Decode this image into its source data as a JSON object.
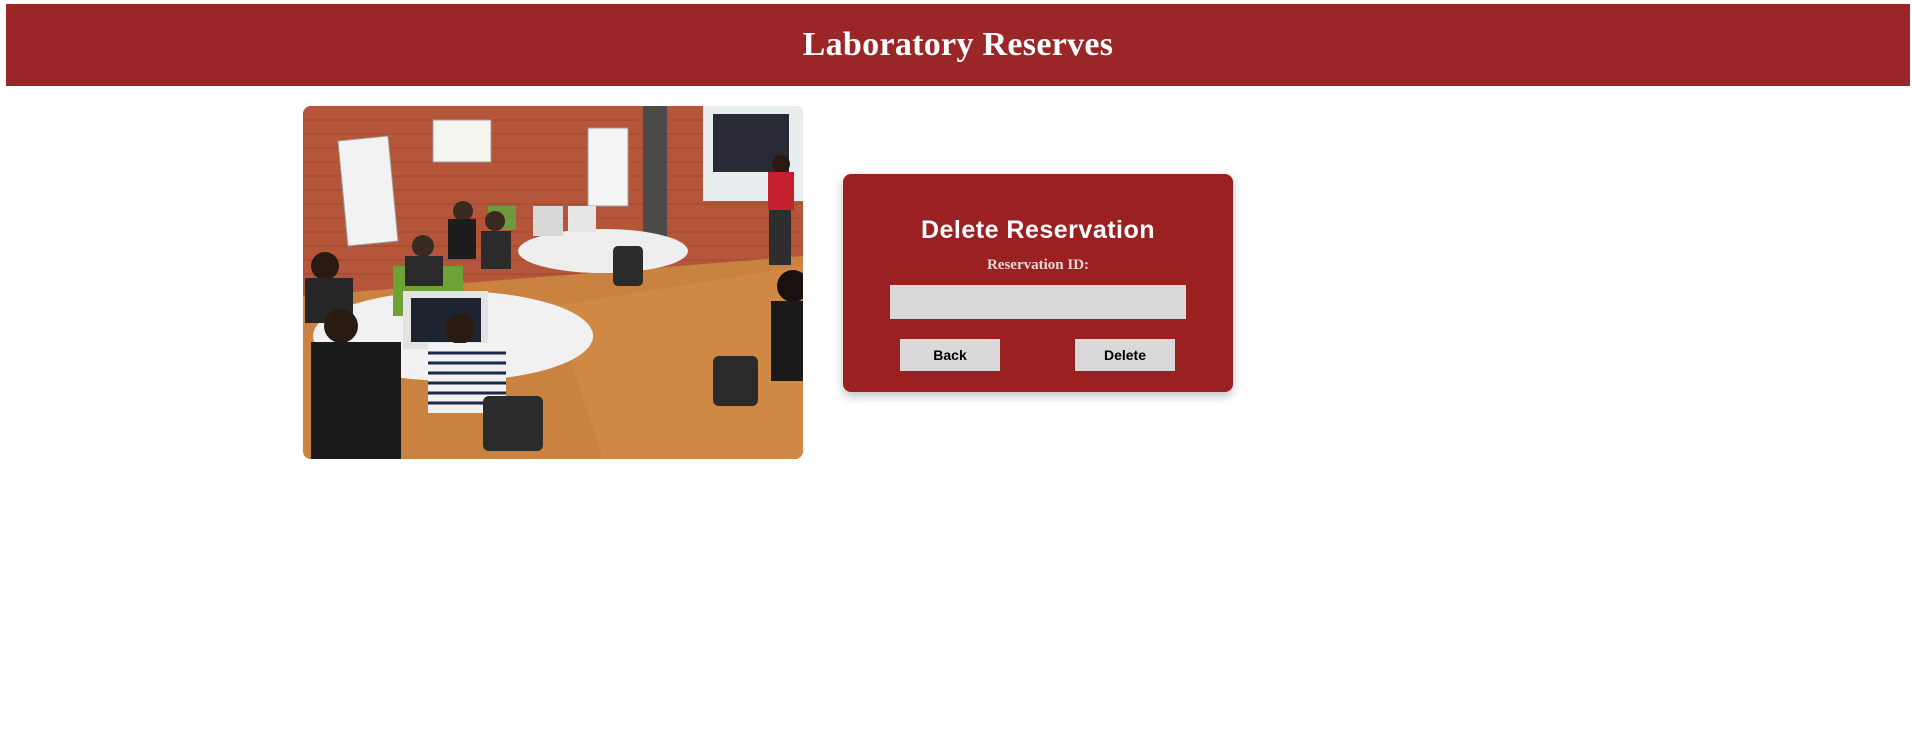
{
  "header": {
    "title": "Laboratory Reserves"
  },
  "photo": {
    "subject": "computer-lab-photo"
  },
  "form": {
    "title": "Delete Reservation",
    "id_label": "Reservation ID:",
    "id_value": "",
    "id_placeholder": "",
    "back_label": "Back",
    "delete_label": "Delete"
  },
  "colors": {
    "brand_red": "#9a2628",
    "card_red": "#9b2021",
    "input_gray": "#d9d9d9"
  }
}
